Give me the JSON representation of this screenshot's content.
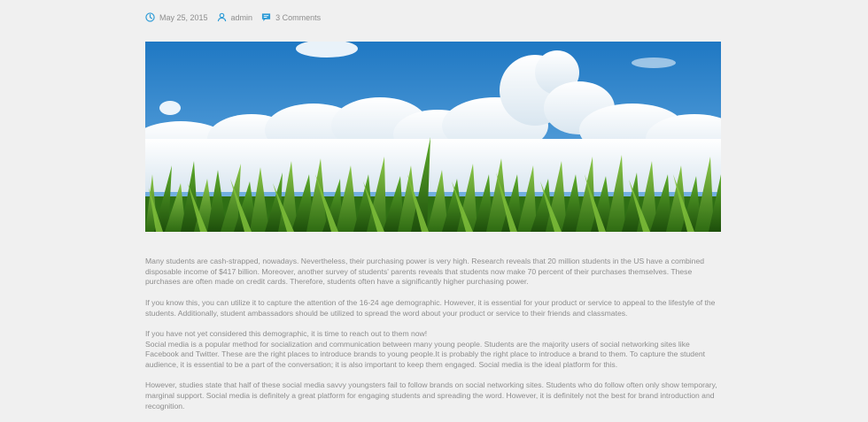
{
  "post": {
    "date": "May 25, 2015",
    "author": "admin",
    "comments": "3 Comments",
    "image_alt": "",
    "paragraphs": [
      "Many students are cash-strapped, nowadays. Nevertheless, their purchasing power is very high. Research reveals that 20 million students in the US have a combined disposable income of $417 billion. Moreover, another survey of students' parents reveals that students now make 70 percent of their purchases themselves. These purchases are often made on credit cards. Therefore, students often have a significantly higher purchasing power.",
      "If you know this, you can utilize it to capture the attention of the 16-24 age demographic. However, it is essential for your product or service to appeal to the lifestyle of the students. Additionally, student ambassadors should be utilized to spread the word about your product or service to their friends and classmates.",
      "If you have not yet considered this demographic, it is time to reach out to them now!",
      "Social media is a popular method for socialization and communication between many young people. Students are the majority users of social networking sites like Facebook and Twitter. These are the right places to introduce brands to young people.It is probably the right place to introduce a brand to them. To capture the student audience, it is essential to be a part of the conversation; it is also important to keep them engaged. Social media is the ideal platform for this.",
      "However, studies state that half of these social media savvy youngsters fail to follow brands on social networking sites. Students who do follow often only show temporary, marginal support. Social media is definitely a great platform for engaging students and spreading the word. However, it is definitely not the best for brand introduction and recognition."
    ]
  },
  "colors": {
    "accent": "#2b9ad6",
    "background": "#f0f0f0",
    "text": "#8e8e8e"
  },
  "icons": {
    "date": "clock-icon",
    "author": "user-icon",
    "comments": "comment-icon"
  }
}
